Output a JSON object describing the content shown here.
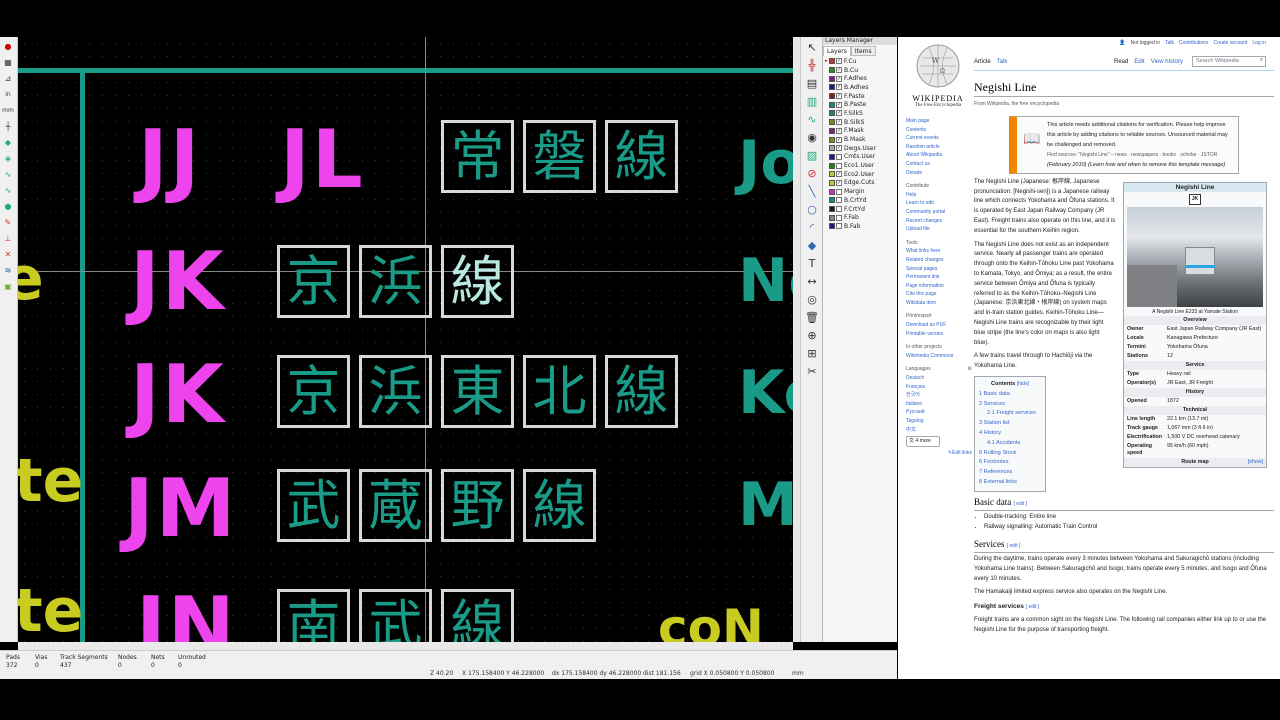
{
  "kicad": {
    "canvas_rows": [
      {
        "code": "JJ",
        "code2": "JL",
        "kanji": [
          "常",
          "磐",
          "線"
        ],
        "right_text": "Jo"
      },
      {
        "code": "JK",
        "kanji": [
          "京",
          "浜",
          "線"
        ],
        "right_text": "Ne",
        "left_text": "e"
      },
      {
        "code": "JK",
        "kanji": [
          "京",
          "浜",
          "東",
          "北",
          "線"
        ],
        "right_text": "Ke"
      },
      {
        "code": "JM",
        "kanji": [
          "武",
          "蔵",
          "野",
          "線"
        ],
        "right_text": "Mu",
        "left_text": "te"
      },
      {
        "code": "JN",
        "kanji": [
          "南",
          "武",
          "線"
        ],
        "right_text": "coN",
        "left_text": "te"
      }
    ],
    "layers_manager": {
      "title": "Layers Manager",
      "tabs": [
        "Layers",
        "Items"
      ],
      "layers": [
        {
          "name": "F.Cu",
          "color": "#c83434",
          "checked": true
        },
        {
          "name": "B.Cu",
          "color": "#2f7f2f",
          "checked": true
        },
        {
          "name": "F.Adhes",
          "color": "#841a84",
          "checked": true
        },
        {
          "name": "B.Adhes",
          "color": "#1a1a84",
          "checked": true
        },
        {
          "name": "F.Paste",
          "color": "#841a1a",
          "checked": true
        },
        {
          "name": "B.Paste",
          "color": "#1a8484",
          "checked": true
        },
        {
          "name": "F.SilkS",
          "color": "#1a8484",
          "checked": true
        },
        {
          "name": "B.SilkS",
          "color": "#84841a",
          "checked": true
        },
        {
          "name": "F.Mask",
          "color": "#841a84",
          "checked": true
        },
        {
          "name": "B.Mask",
          "color": "#84841a",
          "checked": true
        },
        {
          "name": "Dwgs.User",
          "color": "#aaaaaa",
          "checked": true
        },
        {
          "name": "Cmts.User",
          "color": "#1a1a84",
          "checked": false
        },
        {
          "name": "Eco1.User",
          "color": "#1a841a",
          "checked": false
        },
        {
          "name": "Eco2.User",
          "color": "#c8c832",
          "checked": true
        },
        {
          "name": "Edge.Cuts",
          "color": "#c8c832",
          "checked": true
        },
        {
          "name": "Margin",
          "color": "#c832c8",
          "checked": false
        },
        {
          "name": "B.CrtYd",
          "color": "#1a8484",
          "checked": false
        },
        {
          "name": "F.CrtYd",
          "color": "#1a1a1a",
          "checked": false
        },
        {
          "name": "F.Fab",
          "color": "#848484",
          "checked": false
        },
        {
          "name": "B.Fab",
          "color": "#1a1a84",
          "checked": false
        }
      ]
    },
    "status": {
      "stats": [
        {
          "label": "Pads",
          "value": "372"
        },
        {
          "label": "Vias",
          "value": "0"
        },
        {
          "label": "Track Segments",
          "value": "437"
        },
        {
          "label": "Nodes",
          "value": "0"
        },
        {
          "label": "Nets",
          "value": "0"
        },
        {
          "label": "Unrouted",
          "value": "0"
        }
      ],
      "zoom": "Z 40.20",
      "xy": "X 175.158400  Y 46.228000",
      "delta": "dx 175.158400  dy 46.228000  dist 181.156",
      "grid": "grid X 0.050800  Y 0.050800",
      "units": "mm"
    }
  },
  "wiki": {
    "toplinks": [
      "Not logged in",
      "Talk",
      "Contributions",
      "Create account",
      "Log in"
    ],
    "logo_title": "WIKIPEDIA",
    "logo_sub": "The Free Encyclopedia",
    "tabs_left": [
      "Article",
      "Talk"
    ],
    "tabs_right": [
      "Read",
      "Edit",
      "View history"
    ],
    "search_placeholder": "Search Wikipedia",
    "sidebar": {
      "main": [
        "Main page",
        "Contents",
        "Current events",
        "Random article",
        "About Wikipedia",
        "Contact us",
        "Donate"
      ],
      "contribute_h": "Contribute",
      "contribute": [
        "Help",
        "Learn to edit",
        "Community portal",
        "Recent changes",
        "Upload file"
      ],
      "tools_h": "Tools",
      "tools": [
        "What links here",
        "Related changes",
        "Special pages",
        "Permanent link",
        "Page information",
        "Cite this page",
        "Wikidata item"
      ],
      "print_h": "Print/export",
      "print": [
        "Download as PDF",
        "Printable version"
      ],
      "other_h": "In other projects",
      "other": [
        "Wikimedia Commons"
      ],
      "lang_h": "Languages",
      "langs": [
        "Deutsch",
        "Français",
        "한국어",
        "Italiano",
        "Русский",
        "Tagalog",
        "中文"
      ],
      "more_langs": "4 more",
      "edit_links": "Edit links"
    },
    "title": "Negishi Line",
    "from": "From Wikipedia, the free encyclopedia",
    "notice": {
      "line1": "This article needs additional citations for verification. Please help improve this article by adding citations to reliable sources. Unsourced material may be challenged and removed.",
      "line2": "Find sources: \"Negishi Line\" – news · newspapers · books · scholar · JSTOR",
      "line3": "(February 2010) (Learn how and when to remove this template message)"
    },
    "para1": "The Negishi Line (Japanese: 根岸線, Japanese pronunciation: [Negishi-sen]) is a Japanese railway line which connects Yokohama and Ōfuna stations. It is operated by East Japan Railway Company (JR East). Freight trains also operate on this line, and it is essential for the southern Keihin region.",
    "para2": "The Negishi Line does not exist as an independent service. Nearly all passenger trains are operated through onto the Keihin-Tōhoku Line past Yokohama to Kamata, Tokyo, and Ōmiya; as a result, the entire service between Ōmiya and Ōfuna is typically referred to as the Keihin-Tōhoku–Negishi Line (Japanese: 京浜東北線・根岸線) on system maps and in-train station guides. Keihin-Tōhoku Line—Negishi Line trains are recognizable by their light blue stripe (the line's color on maps is also light blue).",
    "para3": "A few trains travel through to Hachiōji via the Yokohama Line.",
    "toc": {
      "title": "Contents",
      "hide": "[hide]",
      "items": [
        "1 Basic data",
        "2 Services",
        "2.1 Freight services",
        "3 Station list",
        "4 History",
        "4.1 Accidents",
        "5 Rolling Stock",
        "6 Footnotes",
        "7 References",
        "8 External links"
      ]
    },
    "basic_h": "Basic data",
    "edit": "[ edit ]",
    "basic_items": [
      "Double-tracking: Entire line",
      "Railway signalling: Automatic Train Control"
    ],
    "services_h": "Services",
    "services_p1": "During the daytime, trains operate every 3 minutes between Yokohama and Sakuragichō stations (including Yokohama Line trains). Between Sakuragichō and Isogo, trains operate every 5 minutes, and Isogo and Ōfuna every 10 minutes.",
    "services_p2": "The Hamakaiji limited express service also operates on the Negishi Line.",
    "freight_h": "Freight services",
    "freight_p": "Freight trains are a common sight on the Negishi Line. The following rail companies either link up to or use the Negishi Line for the purpose of transporting freight.",
    "infobox": {
      "title": "Negishi Line",
      "badge": "JK",
      "caption": "A Negishi Line E233 at Yamate Station",
      "overview_h": "Overview",
      "rows1": [
        {
          "k": "Owner",
          "v": "East Japan Railway Company (JR East)"
        },
        {
          "k": "Locale",
          "v": "Kanagawa Prefecture"
        },
        {
          "k": "Termini",
          "v": "Yokohama Ōfuna"
        },
        {
          "k": "Stations",
          "v": "12"
        }
      ],
      "service_h": "Service",
      "rows2": [
        {
          "k": "Type",
          "v": "Heavy rail"
        },
        {
          "k": "Operator(s)",
          "v": "JR East, JR Freight"
        }
      ],
      "history_h": "History",
      "rows3": [
        {
          "k": "Opened",
          "v": "1872"
        }
      ],
      "technical_h": "Technical",
      "rows4": [
        {
          "k": "Line length",
          "v": "22.1 km (13.7 mi)"
        },
        {
          "k": "Track gauge",
          "v": "1,067 mm (3 ft 6 in)"
        },
        {
          "k": "Electrification",
          "v": "1,500 V DC overhead catenary"
        },
        {
          "k": "Operating speed",
          "v": "95 km/h (60 mph)"
        }
      ],
      "route_map": "Route map",
      "show": "[show]"
    }
  }
}
